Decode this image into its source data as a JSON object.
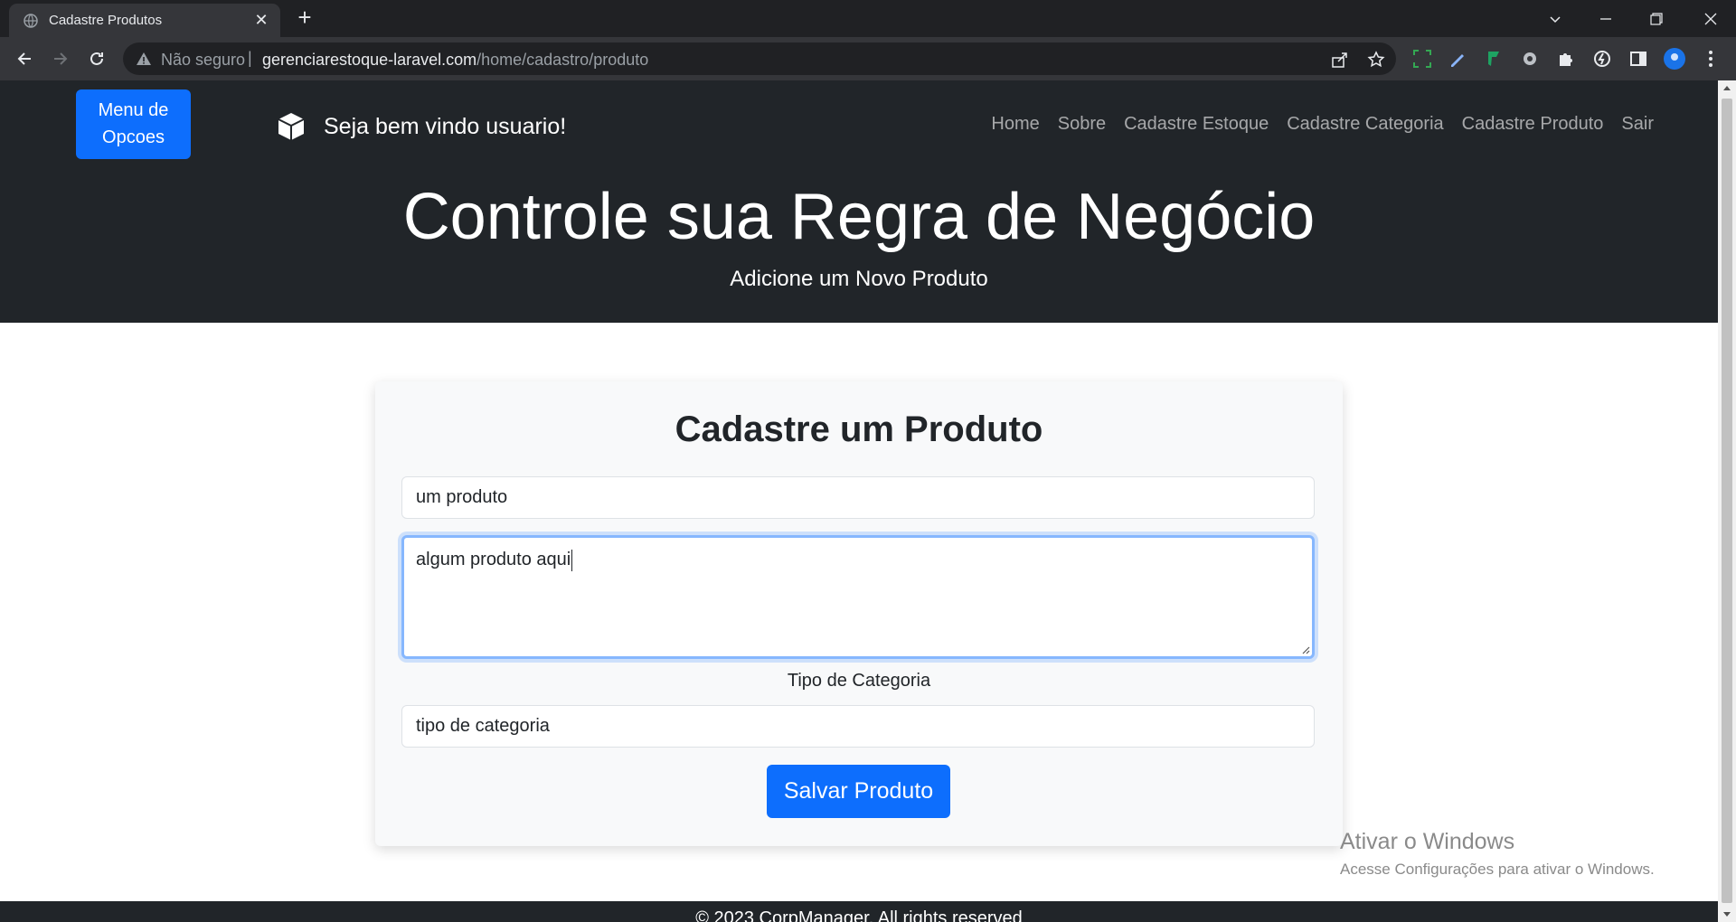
{
  "browser": {
    "tab_title": "Cadastre Produtos",
    "security_label": "Não seguro",
    "url_host": "gerenciarestoque-laravel.com",
    "url_path": "/home/cadastro/produto"
  },
  "nav": {
    "menu_button": "Menu de Opcoes",
    "brand_text": "Seja bem vindo usuario!",
    "links": [
      "Home",
      "Sobre",
      "Cadastre Estoque",
      "Cadastre Categoria",
      "Cadastre Produto",
      "Sair"
    ]
  },
  "hero": {
    "title": "Controle sua Regra de Negócio",
    "subtitle": "Adicione um Novo Produto"
  },
  "form": {
    "title": "Cadastre um Produto",
    "name_value": "um produto",
    "description_value": "algum produto aqui",
    "category_label": "Tipo de Categoria",
    "category_value": "tipo de categoria",
    "submit_label": "Salvar Produto"
  },
  "watermark": {
    "line1": "Ativar o Windows",
    "line2": "Acesse Configurações para ativar o Windows."
  },
  "footer": {
    "text": "© 2023 CorpManager. All rights reserved"
  },
  "colors": {
    "primary": "#0d6efd",
    "dark": "#212529",
    "card_bg": "#f8f9fa"
  }
}
